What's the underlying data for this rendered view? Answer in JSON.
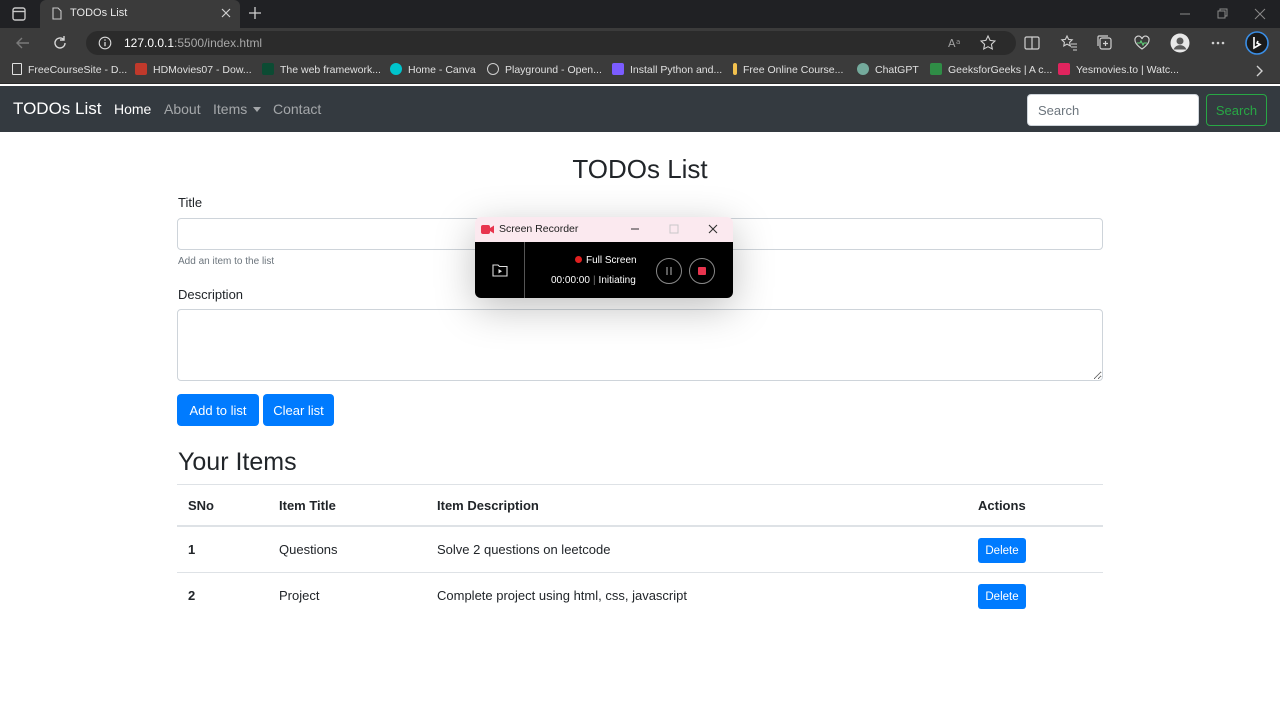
{
  "browser": {
    "tab_title": "TODOs List",
    "url_host": "127.0.0.1",
    "url_path": ":5500/index.html",
    "bookmarks": [
      {
        "label": "FreeCourseSite - D...",
        "color": "#e0e0e0"
      },
      {
        "label": "HDMovies07 - Dow...",
        "color": "#c0392b"
      },
      {
        "label": "The web framework...",
        "color": "#0c4b33"
      },
      {
        "label": "Home - Canva",
        "color": "#00c4cc"
      },
      {
        "label": "Playground - Open...",
        "color": "#cfcfcf"
      },
      {
        "label": "Install Python and...",
        "color": "#7b5cff"
      },
      {
        "label": "Free Online Course...",
        "color": "#f2c14e"
      },
      {
        "label": "ChatGPT",
        "color": "#74aa9c"
      },
      {
        "label": "GeeksforGeeks | A c...",
        "color": "#2f8d46"
      },
      {
        "label": "Yesmovies.to | Watc...",
        "color": "#e0245e"
      }
    ]
  },
  "navbar": {
    "brand": "TODOs List",
    "links": [
      "Home",
      "About",
      "Items",
      "Contact"
    ],
    "search_placeholder": "Search",
    "search_button": "Search"
  },
  "main": {
    "title": "TODOs List",
    "title_label": "Title",
    "title_help": "Add an item to the list",
    "description_label": "Description",
    "add_button": "Add to list",
    "clear_button": "Clear list",
    "section_title": "Your Items",
    "table": {
      "headers": [
        "SNo",
        "Item Title",
        "Item Description",
        "Actions"
      ],
      "rows": [
        {
          "sno": "1",
          "title": "Questions",
          "description": "Solve 2 questions on leetcode",
          "action": "Delete"
        },
        {
          "sno": "2",
          "title": "Project",
          "description": "Complete project using html, css, javascript",
          "action": "Delete"
        }
      ]
    }
  },
  "recorder": {
    "title": "Screen Recorder",
    "mode": "Full Screen",
    "time": "00:00:00",
    "status": "Initiating"
  },
  "colors": {
    "primary": "#007bff",
    "success": "#28a745",
    "navbar": "#343a40"
  }
}
